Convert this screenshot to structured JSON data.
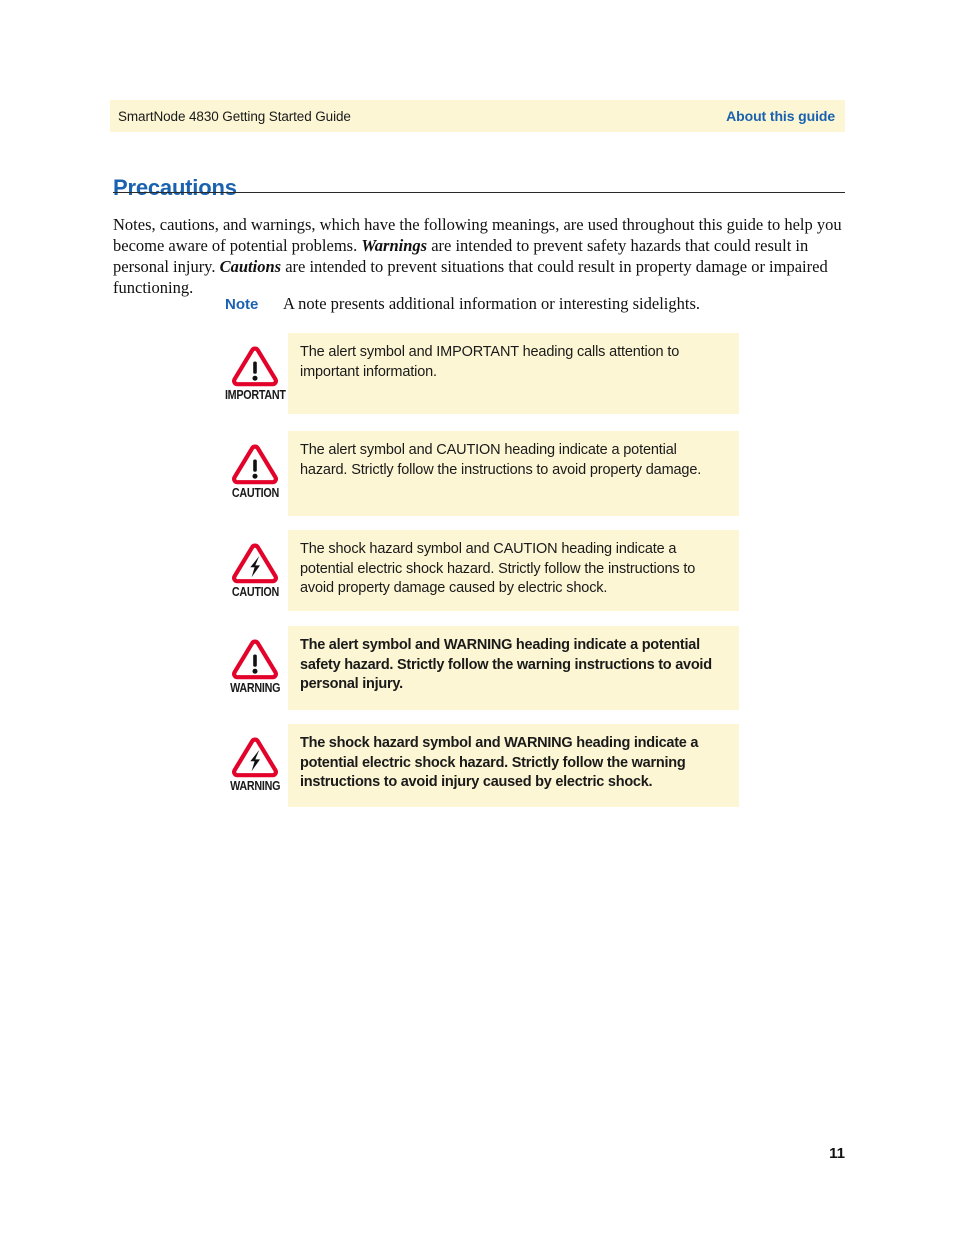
{
  "header": {
    "left_text": "SmartNode 4830 Getting Started Guide",
    "right_text": "About this guide",
    "band_color": "#fcf6d4",
    "accent_color": "#1a62b0"
  },
  "section": {
    "title": "Precautions",
    "intro_part1": "Notes, cautions, and warnings, which have the following meanings, are used throughout this guide to help you become aware of potential problems.  ",
    "intro_em1": "Warnings",
    "intro_part2": " are intended to prevent safety hazards that could result in personal injury. ",
    "intro_em2": "Cautions",
    "intro_part3": " are intended to prevent situations that could result in property damage or impaired functioning."
  },
  "note": {
    "label": "Note",
    "text": "A note presents additional information or interesting sidelights."
  },
  "callouts": [
    {
      "icon": "alert-triangle-exclamation-icon",
      "label": "IMPORTANT",
      "text": "The alert symbol and IMPORTANT heading calls attention to important information.",
      "bold": false
    },
    {
      "icon": "alert-triangle-exclamation-icon",
      "label": "CAUTION",
      "text": "The alert symbol and CAUTION heading indicate a potential hazard. Strictly follow the instructions to avoid property damage.",
      "bold": false
    },
    {
      "icon": "shock-hazard-triangle-icon",
      "label": "CAUTION",
      "text": "The shock hazard symbol and CAUTION heading indicate a potential electric shock hazard. Strictly follow the instructions to avoid property damage caused by electric shock.",
      "bold": false
    },
    {
      "icon": "alert-triangle-exclamation-icon",
      "label": "WARNING",
      "text": "The alert symbol and WARNING heading indicate a potential safety hazard. Strictly follow the warning instructions to avoid personal injury.",
      "bold": true
    },
    {
      "icon": "shock-hazard-triangle-icon",
      "label": "WARNING",
      "text": "The shock hazard symbol and WARNING heading indicate a potential electric shock hazard. Strictly follow the warning instructions to avoid injury caused by electric shock.",
      "bold": true
    }
  ],
  "footer": {
    "page_number": "11"
  },
  "colors": {
    "callout_background": "#fcf6d4",
    "triangle_stroke": "#e3032a",
    "triangle_fill": "#ffffff",
    "glyph": "#111111",
    "heading_blue": "#1a62b0"
  }
}
